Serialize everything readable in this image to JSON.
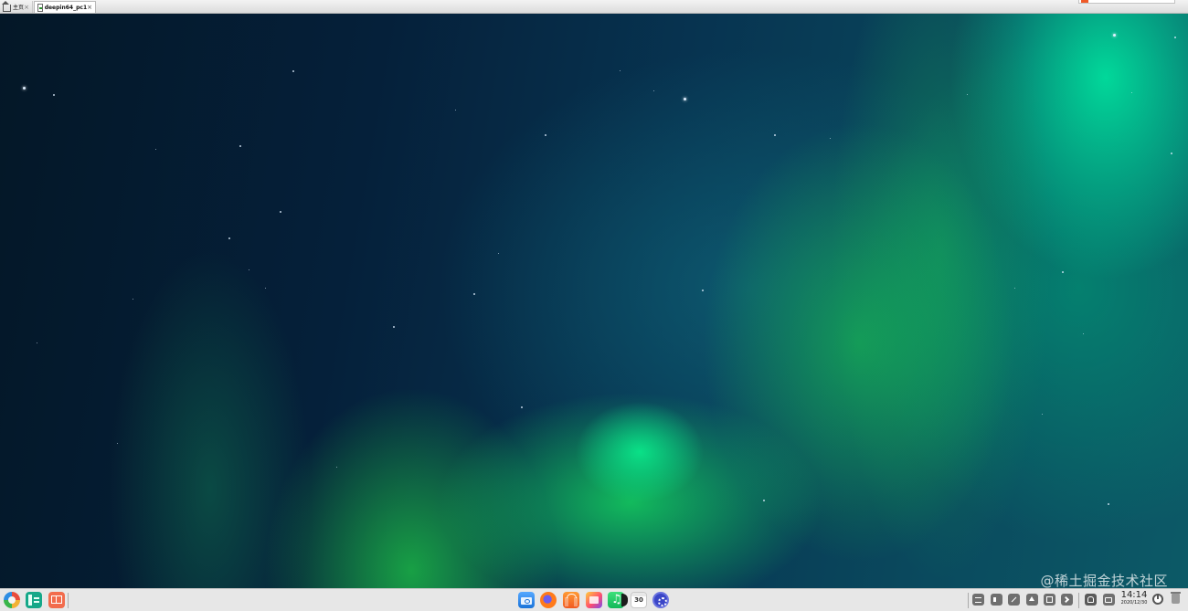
{
  "tabs": [
    {
      "label": "主页",
      "active": false,
      "icon": "home-icon"
    },
    {
      "label": "deepin64_pc1",
      "active": true,
      "icon": "vm-icon"
    }
  ],
  "desktop": {
    "wallpaper": "aurora borealis night sky",
    "watermark": "@稀土掘金技术社区"
  },
  "dock": {
    "left_icons": [
      "launcher-icon",
      "multitask-view-icon",
      "show-desktop-icon"
    ],
    "apps": [
      "file-manager-icon",
      "browser-icon",
      "app-store-icon",
      "image-viewer-icon",
      "music-icon",
      "calendar-icon",
      "control-center-icon"
    ],
    "calendar_day": "30",
    "tray_icons": [
      "keyboard-icon",
      "volume-icon",
      "pen-icon",
      "upload-icon",
      "network-icon",
      "expand-arrow-icon",
      "notification-icon",
      "screen-icon"
    ],
    "clock": {
      "time": "14:14",
      "date": "2020/12/30"
    }
  },
  "colors": {
    "dock_bg": "#e7e7e7",
    "aurora_green": "#14d25f",
    "sky_dark": "#041727"
  }
}
